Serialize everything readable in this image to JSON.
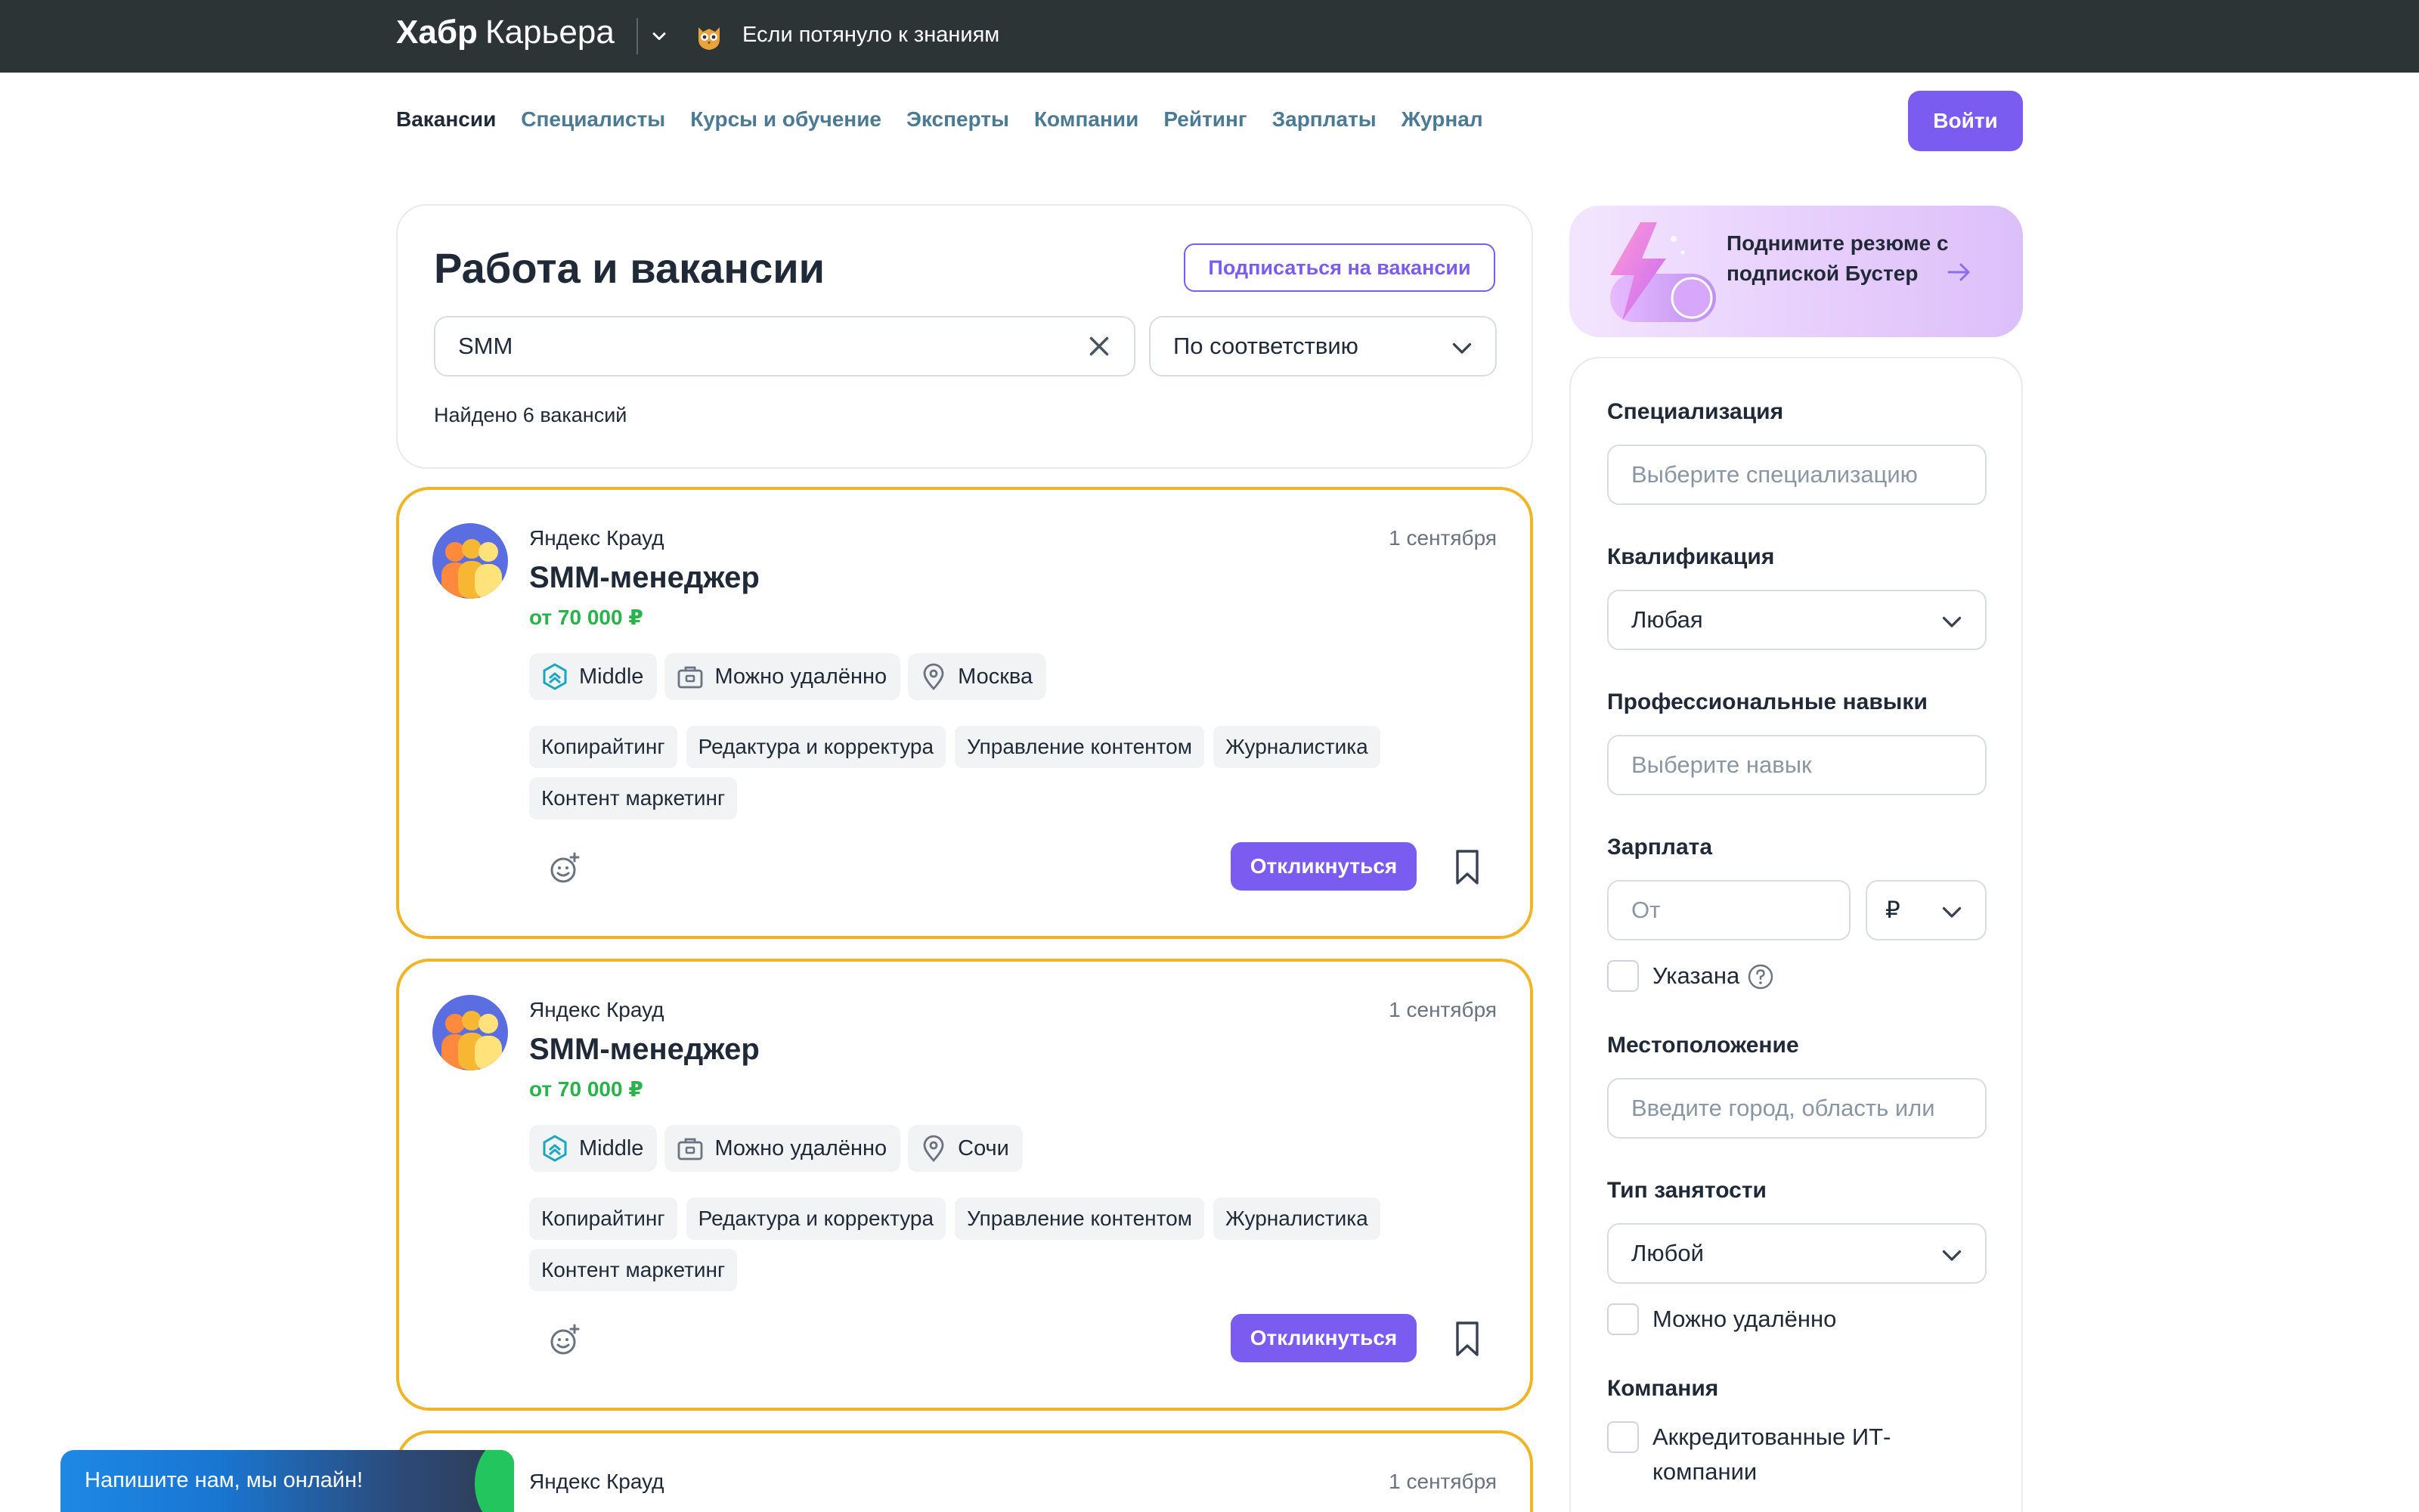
{
  "topbar": {
    "brand_bold": "Хабр",
    "brand_light": "Карьера",
    "promo_text": "Если потянуло к знаниям"
  },
  "nav": {
    "items": [
      "Вакансии",
      "Специалисты",
      "Курсы и обучение",
      "Эксперты",
      "Компании",
      "Рейтинг",
      "Зарплаты",
      "Журнал"
    ],
    "active": "Вакансии",
    "login_label": "Войти"
  },
  "search": {
    "title": "Работа и вакансии",
    "subscribe_label": "Подписаться на вакансии",
    "query": "SMM",
    "sort_value": "По соответствию",
    "found_text": "Найдено 6 вакансий"
  },
  "vacancies": [
    {
      "company": "Яндекс Крауд",
      "date": "1 сентября",
      "title": "SMM-менеджер",
      "salary": "от 70 000 ₽",
      "level": "Middle",
      "remote": "Можно удалённо",
      "city": "Москва",
      "skills": [
        "Копирайтинг",
        "Редактура и корректура",
        "Управление контентом",
        "Журналистика",
        "Контент маркетинг"
      ],
      "apply_label": "Откликнуться"
    },
    {
      "company": "Яндекс Крауд",
      "date": "1 сентября",
      "title": "SMM-менеджер",
      "salary": "от 70 000 ₽",
      "level": "Middle",
      "remote": "Можно удалённо",
      "city": "Сочи",
      "skills": [
        "Копирайтинг",
        "Редактура и корректура",
        "Управление контентом",
        "Журналистика",
        "Контент маркетинг"
      ],
      "apply_label": "Откликнуться"
    },
    {
      "company": "Яндекс Крауд",
      "date": "1 сентября"
    }
  ],
  "booster": {
    "text": "Поднимите резюме с подпиской Бустер"
  },
  "filters": {
    "specialization": {
      "label": "Специализация",
      "placeholder": "Выберите специализацию"
    },
    "qualification": {
      "label": "Квалификация",
      "value": "Любая"
    },
    "skills": {
      "label": "Профессиональные навыки",
      "placeholder": "Выберите навык"
    },
    "salary": {
      "label": "Зарплата",
      "from_placeholder": "От",
      "currency": "₽",
      "specified_label": "Указана"
    },
    "location": {
      "label": "Местоположение",
      "placeholder": "Введите город, область или"
    },
    "employment": {
      "label": "Тип занятости",
      "value": "Любой",
      "remote_label": "Можно удалённо"
    },
    "company": {
      "label": "Компания",
      "accredited_label": "Аккредитованные ИТ-компании"
    }
  },
  "chat": {
    "text": "Напишите нам, мы онлайн!"
  },
  "colors": {
    "accent": "#7b5cf0",
    "highlight_border": "#f0b429",
    "salary": "#2bb24c",
    "topbar": "#2d3436"
  }
}
